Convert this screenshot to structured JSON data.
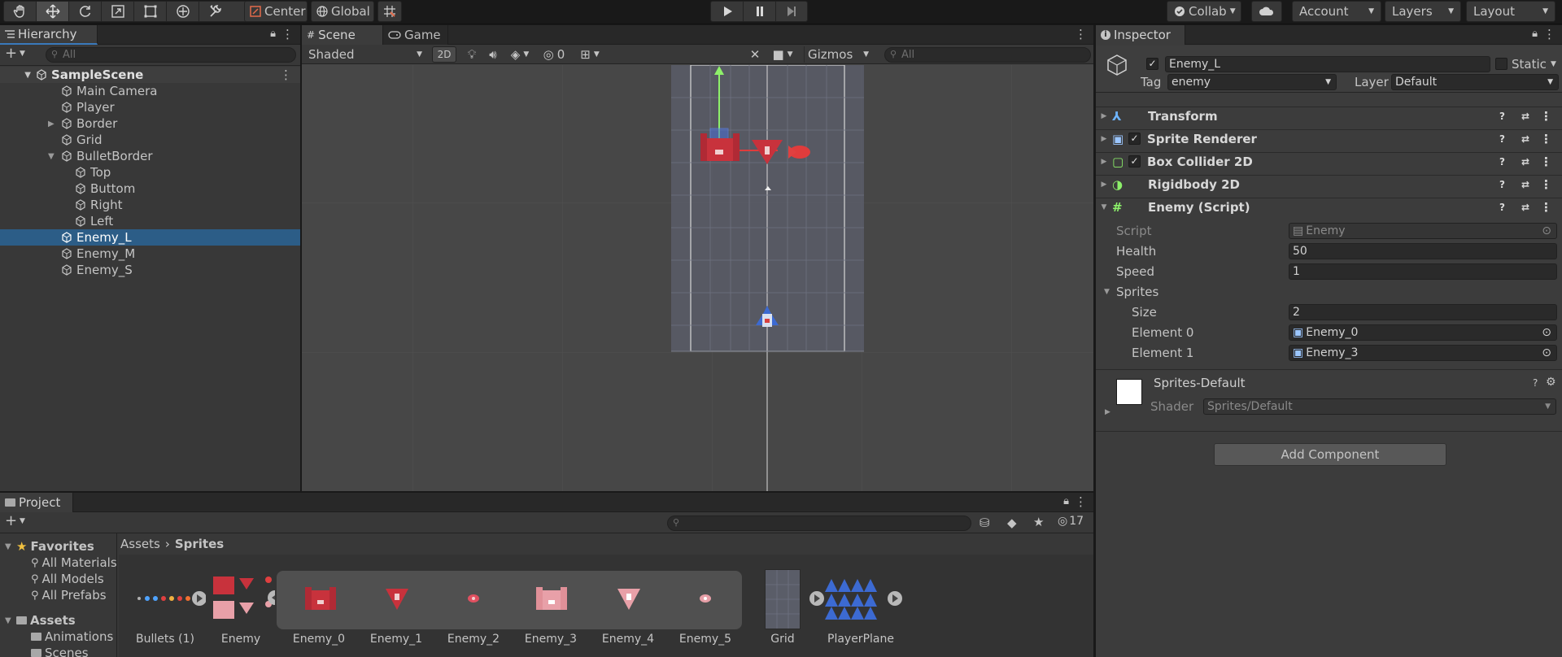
{
  "toolbar": {
    "pivot": "Center",
    "space": "Global",
    "collab": "Collab",
    "account": "Account",
    "layers": "Layers",
    "layout": "Layout"
  },
  "hierarchy": {
    "tab": "Hierarchy",
    "search_placeholder": "All",
    "scene": "SampleScene",
    "items": [
      {
        "label": "Main Camera"
      },
      {
        "label": "Player"
      },
      {
        "label": "Border"
      },
      {
        "label": "Grid"
      },
      {
        "label": "BulletBorder"
      },
      {
        "label": "Top"
      },
      {
        "label": "Buttom"
      },
      {
        "label": "Right"
      },
      {
        "label": "Left"
      },
      {
        "label": "Enemy_L"
      },
      {
        "label": "Enemy_M"
      },
      {
        "label": "Enemy_S"
      }
    ]
  },
  "scene": {
    "tabs": [
      "Scene",
      "Game"
    ],
    "shading": "Shaded",
    "mode_2d": "2D",
    "hidden_count": "0",
    "gizmos": "Gizmos",
    "search_placeholder": "All"
  },
  "inspector": {
    "tab": "Inspector",
    "object_name": "Enemy_L",
    "static_label": "Static",
    "tag_label": "Tag",
    "tag_value": "enemy",
    "layer_label": "Layer",
    "layer_value": "Default",
    "components": [
      {
        "name": "Transform"
      },
      {
        "name": "Sprite Renderer"
      },
      {
        "name": "Box Collider 2D"
      },
      {
        "name": "Rigidbody 2D"
      },
      {
        "name": "Enemy (Script)"
      }
    ],
    "script_label": "Script",
    "script_value": "Enemy",
    "health_label": "Health",
    "health_value": "50",
    "speed_label": "Speed",
    "speed_value": "1",
    "sprites_label": "Sprites",
    "size_label": "Size",
    "size_value": "2",
    "element0_label": "Element 0",
    "element0_value": "Enemy_0",
    "element1_label": "Element 1",
    "element1_value": "Enemy_3",
    "material_name": "Sprites-Default",
    "shader_label": "Shader",
    "shader_value": "Sprites/Default",
    "add_component": "Add Component"
  },
  "project": {
    "tab": "Project",
    "hidden_count": "17",
    "favorites": "Favorites",
    "favorite_items": [
      "All Materials",
      "All Models",
      "All Prefabs"
    ],
    "assets": "Assets",
    "asset_folders": [
      "Animations",
      "Scenes"
    ],
    "breadcrumb_root": "Assets",
    "breadcrumb_current": "Sprites",
    "grid_items": [
      "Bullets (1)",
      "Enemy",
      "Enemy_0",
      "Enemy_1",
      "Enemy_2",
      "Enemy_3",
      "Enemy_4",
      "Enemy_5",
      "Grid",
      "PlayerPlane"
    ]
  },
  "colors": {
    "selection": "#2c5d87",
    "panel": "#383838",
    "enemy_red": "#c8323c",
    "player_blue": "#3c6ad2"
  }
}
